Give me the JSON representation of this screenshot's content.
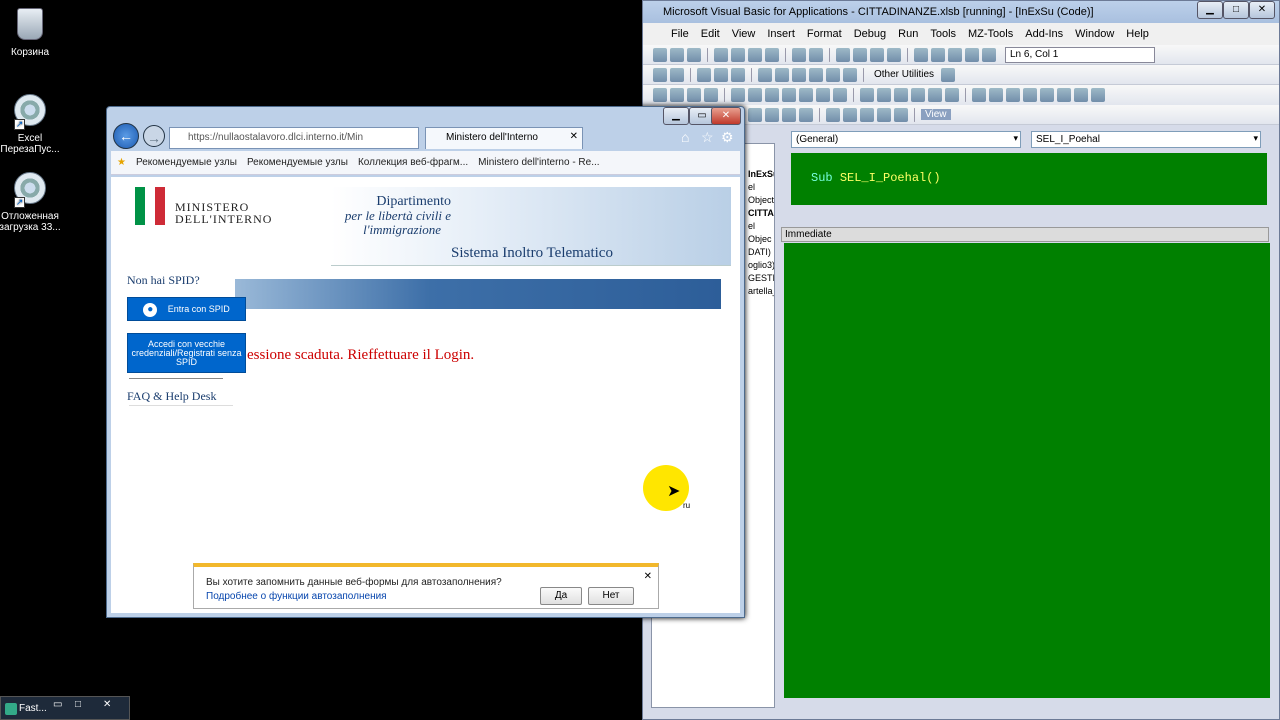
{
  "desktop": {
    "icons": [
      {
        "label": "Корзина"
      },
      {
        "label": "Excel ПерезаПус..."
      },
      {
        "label": "Отложенная загрузка 33..."
      }
    ]
  },
  "vba": {
    "title": "Microsoft Visual Basic for Applications - CITTADINANZE.xlsb [running] - [InExSu (Code)]",
    "menu": [
      "File",
      "Edit",
      "View",
      "Insert",
      "Format",
      "Debug",
      "Run",
      "Tools",
      "MZ-Tools",
      "Add-Ins",
      "Window",
      "Help"
    ],
    "position": "Ln 6, Col 1",
    "other_utilities": "Other Utilities",
    "view_btn": "View",
    "dd_general": "(General)",
    "dd_proc": "SEL_I_Poehal",
    "code_keyword": "Sub",
    "code_name": "SEL_I_Poehal()",
    "immediate": "Immediate",
    "project_lines": [
      "InExSu",
      "el Object",
      "",
      "CITTADI",
      "el Objec",
      "DATI)",
      "oglio3)",
      "GESTION",
      "artella_"
    ]
  },
  "ie": {
    "url": "https://nullaostalavoro.dlci.interno.it/Min",
    "tab_title": "Ministero dell'Interno",
    "favorites": [
      "Рекомендуемые узлы",
      "Рекомендуемые узлы",
      "Коллекция веб-фрагм...",
      "Ministero dell'interno - Re..."
    ],
    "logo_line1": "MINISTERO",
    "logo_line2": "DELL'INTERNO",
    "dept_title": "Dipartimento",
    "dept_sub1": "per le libertà civili e",
    "dept_sub2": "l'immigrazione",
    "system_name": "Sistema Inoltro Telematico",
    "no_spid": "Non hai SPID?",
    "spid_button": "Entra con SPID",
    "old_login_button": "Accedi con vecchie credenziali/Registrati senza SPID",
    "faq": "FAQ & Help Desk",
    "session_msg": "essione scaduta. Rieffettuare il Login.",
    "notif_text": "Вы хотите запомнить данные веб-формы для автозаполнения?",
    "notif_link": "Подробнее о функции автозаполнения",
    "notif_yes": "Да",
    "notif_no": "Нет",
    "cursor_label": "ru"
  },
  "taskbar": {
    "label": "Fast..."
  }
}
